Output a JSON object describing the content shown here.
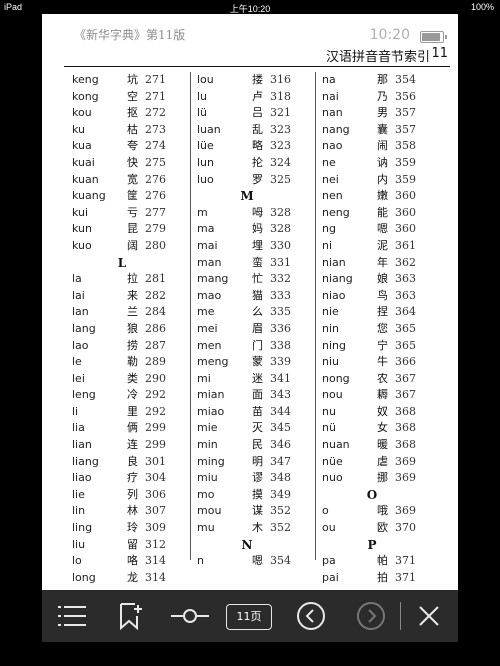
{
  "status": {
    "device": "iPad",
    "time": "上午10:20",
    "battery": "100%"
  },
  "header": {
    "book_title": "《新华字典》第11版",
    "clock": "10:20",
    "running_head": "汉语拼音音节索引",
    "page_number": "11"
  },
  "columns": [
    [
      {
        "py": "keng",
        "hz": "坑",
        "pg": "271"
      },
      {
        "py": "kong",
        "hz": "空",
        "pg": "271"
      },
      {
        "py": "kou",
        "hz": "抠",
        "pg": "272"
      },
      {
        "py": "ku",
        "hz": "枯",
        "pg": "273"
      },
      {
        "py": "kua",
        "hz": "夸",
        "pg": "274"
      },
      {
        "py": "kuai",
        "hz": "快",
        "pg": "275"
      },
      {
        "py": "kuan",
        "hz": "宽",
        "pg": "276"
      },
      {
        "py": "kuang",
        "hz": "筐",
        "pg": "276"
      },
      {
        "py": "kui",
        "hz": "亏",
        "pg": "277"
      },
      {
        "py": "kun",
        "hz": "昆",
        "pg": "279"
      },
      {
        "py": "kuo",
        "hz": "阔",
        "pg": "280"
      },
      {
        "letter": "L"
      },
      {
        "py": "la",
        "hz": "拉",
        "pg": "281"
      },
      {
        "py": "lai",
        "hz": "来",
        "pg": "282"
      },
      {
        "py": "lan",
        "hz": "兰",
        "pg": "284"
      },
      {
        "py": "lang",
        "hz": "狼",
        "pg": "286"
      },
      {
        "py": "lao",
        "hz": "捞",
        "pg": "287"
      },
      {
        "py": "le",
        "hz": "勒",
        "pg": "289"
      },
      {
        "py": "lei",
        "hz": "类",
        "pg": "290"
      },
      {
        "py": "leng",
        "hz": "冷",
        "pg": "292"
      },
      {
        "py": "li",
        "hz": "里",
        "pg": "292"
      },
      {
        "py": "lia",
        "hz": "俩",
        "pg": "299"
      },
      {
        "py": "lian",
        "hz": "连",
        "pg": "299"
      },
      {
        "py": "liang",
        "hz": "良",
        "pg": "301"
      },
      {
        "py": "liao",
        "hz": "疗",
        "pg": "304"
      },
      {
        "py": "lie",
        "hz": "列",
        "pg": "306"
      },
      {
        "py": "lin",
        "hz": "林",
        "pg": "307"
      },
      {
        "py": "ling",
        "hz": "玲",
        "pg": "309"
      },
      {
        "py": "liu",
        "hz": "留",
        "pg": "312"
      },
      {
        "py": "lo",
        "hz": "咯",
        "pg": "314"
      },
      {
        "py": "long",
        "hz": "龙",
        "pg": "314"
      }
    ],
    [
      {
        "py": "lou",
        "hz": "搂",
        "pg": "316"
      },
      {
        "py": "lu",
        "hz": "卢",
        "pg": "318"
      },
      {
        "py": "lü",
        "hz": "吕",
        "pg": "321"
      },
      {
        "py": "luan",
        "hz": "乱",
        "pg": "323"
      },
      {
        "py": "lüe",
        "hz": "略",
        "pg": "323"
      },
      {
        "py": "lun",
        "hz": "抡",
        "pg": "324"
      },
      {
        "py": "luo",
        "hz": "罗",
        "pg": "325"
      },
      {
        "letter": "M"
      },
      {
        "py": "m",
        "hz": "呣",
        "pg": "328"
      },
      {
        "py": "ma",
        "hz": "妈",
        "pg": "328"
      },
      {
        "py": "mai",
        "hz": "埋",
        "pg": "330"
      },
      {
        "py": "man",
        "hz": "蛮",
        "pg": "331"
      },
      {
        "py": "mang",
        "hz": "忙",
        "pg": "332"
      },
      {
        "py": "mao",
        "hz": "猫",
        "pg": "333"
      },
      {
        "py": "me",
        "hz": "么",
        "pg": "335"
      },
      {
        "py": "mei",
        "hz": "眉",
        "pg": "336"
      },
      {
        "py": "men",
        "hz": "门",
        "pg": "338"
      },
      {
        "py": "meng",
        "hz": "蒙",
        "pg": "339"
      },
      {
        "py": "mi",
        "hz": "迷",
        "pg": "341"
      },
      {
        "py": "mian",
        "hz": "面",
        "pg": "343"
      },
      {
        "py": "miao",
        "hz": "苗",
        "pg": "344"
      },
      {
        "py": "mie",
        "hz": "灭",
        "pg": "345"
      },
      {
        "py": "min",
        "hz": "民",
        "pg": "346"
      },
      {
        "py": "ming",
        "hz": "明",
        "pg": "347"
      },
      {
        "py": "miu",
        "hz": "谬",
        "pg": "348"
      },
      {
        "py": "mo",
        "hz": "摸",
        "pg": "349"
      },
      {
        "py": "mou",
        "hz": "谋",
        "pg": "352"
      },
      {
        "py": "mu",
        "hz": "木",
        "pg": "352"
      },
      {
        "letter": "N"
      },
      {
        "py": "n",
        "hz": "嗯",
        "pg": "354"
      }
    ],
    [
      {
        "py": "na",
        "hz": "那",
        "pg": "354"
      },
      {
        "py": "nai",
        "hz": "乃",
        "pg": "356"
      },
      {
        "py": "nan",
        "hz": "男",
        "pg": "357"
      },
      {
        "py": "nang",
        "hz": "囊",
        "pg": "357"
      },
      {
        "py": "nao",
        "hz": "闹",
        "pg": "358"
      },
      {
        "py": "ne",
        "hz": "讷",
        "pg": "359"
      },
      {
        "py": "nei",
        "hz": "内",
        "pg": "359"
      },
      {
        "py": "nen",
        "hz": "嫩",
        "pg": "360"
      },
      {
        "py": "neng",
        "hz": "能",
        "pg": "360"
      },
      {
        "py": "ng",
        "hz": "嗯",
        "pg": "360"
      },
      {
        "py": "ni",
        "hz": "泥",
        "pg": "361"
      },
      {
        "py": "nian",
        "hz": "年",
        "pg": "362"
      },
      {
        "py": "niang",
        "hz": "娘",
        "pg": "363"
      },
      {
        "py": "niao",
        "hz": "鸟",
        "pg": "363"
      },
      {
        "py": "nie",
        "hz": "捏",
        "pg": "364"
      },
      {
        "py": "nin",
        "hz": "您",
        "pg": "365"
      },
      {
        "py": "ning",
        "hz": "宁",
        "pg": "365"
      },
      {
        "py": "niu",
        "hz": "牛",
        "pg": "366"
      },
      {
        "py": "nong",
        "hz": "农",
        "pg": "367"
      },
      {
        "py": "nou",
        "hz": "耨",
        "pg": "367"
      },
      {
        "py": "nu",
        "hz": "奴",
        "pg": "368"
      },
      {
        "py": "nü",
        "hz": "女",
        "pg": "368"
      },
      {
        "py": "nuan",
        "hz": "暖",
        "pg": "368"
      },
      {
        "py": "nüe",
        "hz": "虐",
        "pg": "369"
      },
      {
        "py": "nuo",
        "hz": "挪",
        "pg": "369"
      },
      {
        "letter": "O"
      },
      {
        "py": "o",
        "hz": "哦",
        "pg": "369"
      },
      {
        "py": "ou",
        "hz": "欧",
        "pg": "370"
      },
      {
        "letter": "P"
      },
      {
        "py": "pa",
        "hz": "帕",
        "pg": "371"
      },
      {
        "py": "pai",
        "hz": "拍",
        "pg": "371"
      }
    ]
  ],
  "toolbar": {
    "page_label": "11页",
    "icons": [
      "list-icon",
      "bookmark-add-icon",
      "brightness-slider-icon",
      "prev-chapter-icon",
      "next-chapter-icon",
      "close-icon"
    ]
  }
}
